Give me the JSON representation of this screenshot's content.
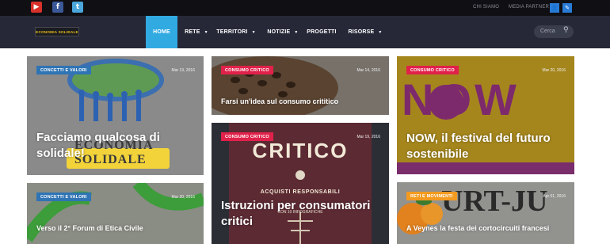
{
  "top_bar": {
    "social": [
      {
        "icon": "youtube-icon",
        "glyph": "▶"
      },
      {
        "icon": "facebook-icon",
        "glyph": "f"
      },
      {
        "icon": "twitter-icon",
        "glyph": "t"
      }
    ],
    "links": [
      "CHI SIAMO",
      "MEDIA PARTNER"
    ],
    "buttons": [
      {
        "icon": "user-icon",
        "glyph": "👤"
      },
      {
        "icon": "pencil-icon",
        "glyph": "✎"
      }
    ]
  },
  "header": {
    "logo_text": "ECONOMIA SOLIDALE",
    "nav": [
      {
        "label": "HOME",
        "active": true,
        "dropdown": false
      },
      {
        "label": "RETE",
        "dropdown": true
      },
      {
        "label": "TERRITORI",
        "dropdown": true
      },
      {
        "label": "NOTIZIE",
        "dropdown": true
      },
      {
        "label": "PROGETTI",
        "dropdown": false
      },
      {
        "label": "RISORSE",
        "dropdown": true
      }
    ],
    "caret": "▼",
    "search": {
      "placeholder": "Cerca",
      "icon": "search-icon",
      "glyph": "⚲"
    }
  },
  "colors": {
    "nav_active": "#31aae2",
    "badge_blue": "#2f74b4",
    "badge_red": "#e0214a",
    "badge_orange": "#f39a1f"
  },
  "cards": [
    {
      "category": "CONCETTI E VALORI",
      "date": "Mar 13, 2016",
      "title": "Facciamo qualcosa di solidale!"
    },
    {
      "category": "CONSUMO CRITICO",
      "date": "Mar 14, 2016",
      "title": "Farsi un'idea sul consumo crititico"
    },
    {
      "category": "CONSUMO CRITICO",
      "date": "Mar 20, 2016",
      "title": "NOW, il festival del futuro sostenibile"
    },
    {
      "category": "CONSUMO CRITICO",
      "date": "Mar 19, 2016",
      "title": "Istruzioni per consumatori critici"
    },
    {
      "category": "CONCETTI E VALORI",
      "date": "Mar 20, 2016",
      "title": "Verso il 2° Forum di Etica Civile"
    },
    {
      "category": "RETI E MOVIMENTI",
      "date": "Apr 01, 2016",
      "title": "A Veynes la festa dei cortocircuiti francesi"
    }
  ],
  "images": {
    "card1": "ECONOMIA SOLIDALE",
    "card3": "NOW",
    "card4_main": "CRITICO",
    "card4_sub": "ACQUISTI RESPONSABILI",
    "card4_small": "CON 10 INFOGRAFICHE",
    "card6": "URT-JU"
  }
}
